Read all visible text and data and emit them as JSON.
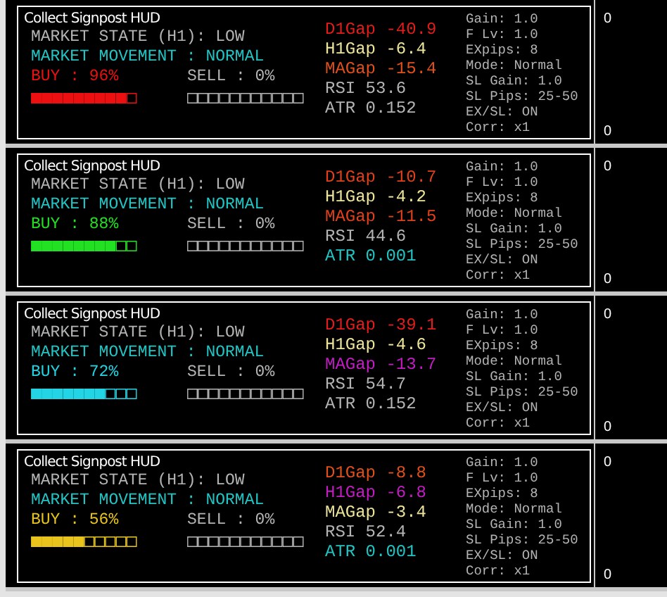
{
  "panes": [
    {
      "title": "Collect Signpost HUD",
      "market_state": {
        "text": "MARKET STATE (H1): LOW",
        "color": "#b4b4b4"
      },
      "market_movement": {
        "text": "MARKET MOVEMENT : NORMAL",
        "color": "#22c4c4"
      },
      "buy": {
        "text": "BUY : 96%",
        "bar": "■■■■■■■■■□",
        "color": "#ee1010"
      },
      "sell": {
        "text": "SELL : 0%",
        "bar": "□□□□□□□□□□□",
        "color": "#b4b4b4"
      },
      "indicators": [
        {
          "text": "D1Gap -40.9",
          "color": "#e41c1c"
        },
        {
          "text": "H1Gap -6.4",
          "color": "#ece49a"
        },
        {
          "text": "MAGap -15.4",
          "color": "#e0501c"
        },
        {
          "text": "RSI 53.6",
          "color": "#b4b4b4"
        },
        {
          "text": "ATR 0.152",
          "color": "#b4b4b4"
        }
      ],
      "settings": [
        "Gain: 1.0",
        "F Lv: 1.0",
        "EXpips: 8",
        "Mode: Normal",
        "SL Gain: 1.0",
        "SL Pips: 25-50",
        "EX/SL: ON",
        "Corr: x1"
      ],
      "scale": [
        "0",
        "0"
      ]
    },
    {
      "title": "Collect Signpost HUD",
      "market_state": {
        "text": "MARKET STATE (H1): LOW",
        "color": "#b4b4b4"
      },
      "market_movement": {
        "text": "MARKET MOVEMENT : NORMAL",
        "color": "#22c4c4"
      },
      "buy": {
        "text": "BUY : 88%",
        "bar": "■■■■■■■■□□",
        "color": "#22e022"
      },
      "sell": {
        "text": "SELL : 0%",
        "bar": "□□□□□□□□□□□",
        "color": "#b4b4b4"
      },
      "indicators": [
        {
          "text": "D1Gap -10.7",
          "color": "#e0401c"
        },
        {
          "text": "H1Gap -4.2",
          "color": "#ece49a"
        },
        {
          "text": "MAGap -11.5",
          "color": "#e0401c"
        },
        {
          "text": "RSI 44.6",
          "color": "#b4b4b4"
        },
        {
          "text": "ATR 0.001",
          "color": "#22c4c4"
        }
      ],
      "settings": [
        "Gain: 1.0",
        "F Lv: 1.0",
        "EXpips: 8",
        "Mode: Normal",
        "SL Gain: 1.0",
        "SL Pips: 25-50",
        "EX/SL: ON",
        "Corr: x1"
      ],
      "scale": [
        "0",
        "0"
      ]
    },
    {
      "title": "Collect Signpost HUD",
      "market_state": {
        "text": "MARKET STATE (H1): LOW",
        "color": "#b4b4b4"
      },
      "market_movement": {
        "text": "MARKET MOVEMENT : NORMAL",
        "color": "#22c4c4"
      },
      "buy": {
        "text": "BUY : 72%",
        "bar": "■■■■■■■□□□",
        "color": "#22d4e4"
      },
      "sell": {
        "text": "SELL : 0%",
        "bar": "□□□□□□□□□□□",
        "color": "#b4b4b4"
      },
      "indicators": [
        {
          "text": "D1Gap -39.1",
          "color": "#e41c1c"
        },
        {
          "text": "H1Gap -4.6",
          "color": "#ece49a"
        },
        {
          "text": "MAGap -13.7",
          "color": "#c41cc4"
        },
        {
          "text": "RSI 54.7",
          "color": "#b4b4b4"
        },
        {
          "text": "ATR 0.152",
          "color": "#b4b4b4"
        }
      ],
      "settings": [
        "Gain: 1.0",
        "F Lv: 1.0",
        "EXpips: 8",
        "Mode: Normal",
        "SL Gain: 1.0",
        "SL Pips: 25-50",
        "EX/SL: ON",
        "Corr: x1"
      ],
      "scale": [
        "0",
        "0"
      ]
    },
    {
      "title": "Collect Signpost HUD",
      "market_state": {
        "text": "MARKET STATE (H1): LOW",
        "color": "#b4b4b4"
      },
      "market_movement": {
        "text": "MARKET MOVEMENT : NORMAL",
        "color": "#22c4c4"
      },
      "buy": {
        "text": "BUY : 56%",
        "bar": "■■■■■□□□□□",
        "color": "#e8c41c"
      },
      "sell": {
        "text": "SELL : 0%",
        "bar": "□□□□□□□□□□□",
        "color": "#b4b4b4"
      },
      "indicators": [
        {
          "text": "D1Gap -8.8",
          "color": "#e0501c"
        },
        {
          "text": "H1Gap -6.8",
          "color": "#c41cc4"
        },
        {
          "text": "MAGap -3.4",
          "color": "#ece49a"
        },
        {
          "text": "RSI 52.4",
          "color": "#b4b4b4"
        },
        {
          "text": "ATR 0.001",
          "color": "#22c4c4"
        }
      ],
      "settings": [
        "Gain: 1.0",
        "F Lv: 1.0",
        "EXpips: 8",
        "Mode: Normal",
        "SL Gain: 1.0",
        "SL Pips: 25-50",
        "EX/SL: ON",
        "Corr: x1"
      ],
      "scale": [
        "0",
        "0"
      ]
    }
  ]
}
